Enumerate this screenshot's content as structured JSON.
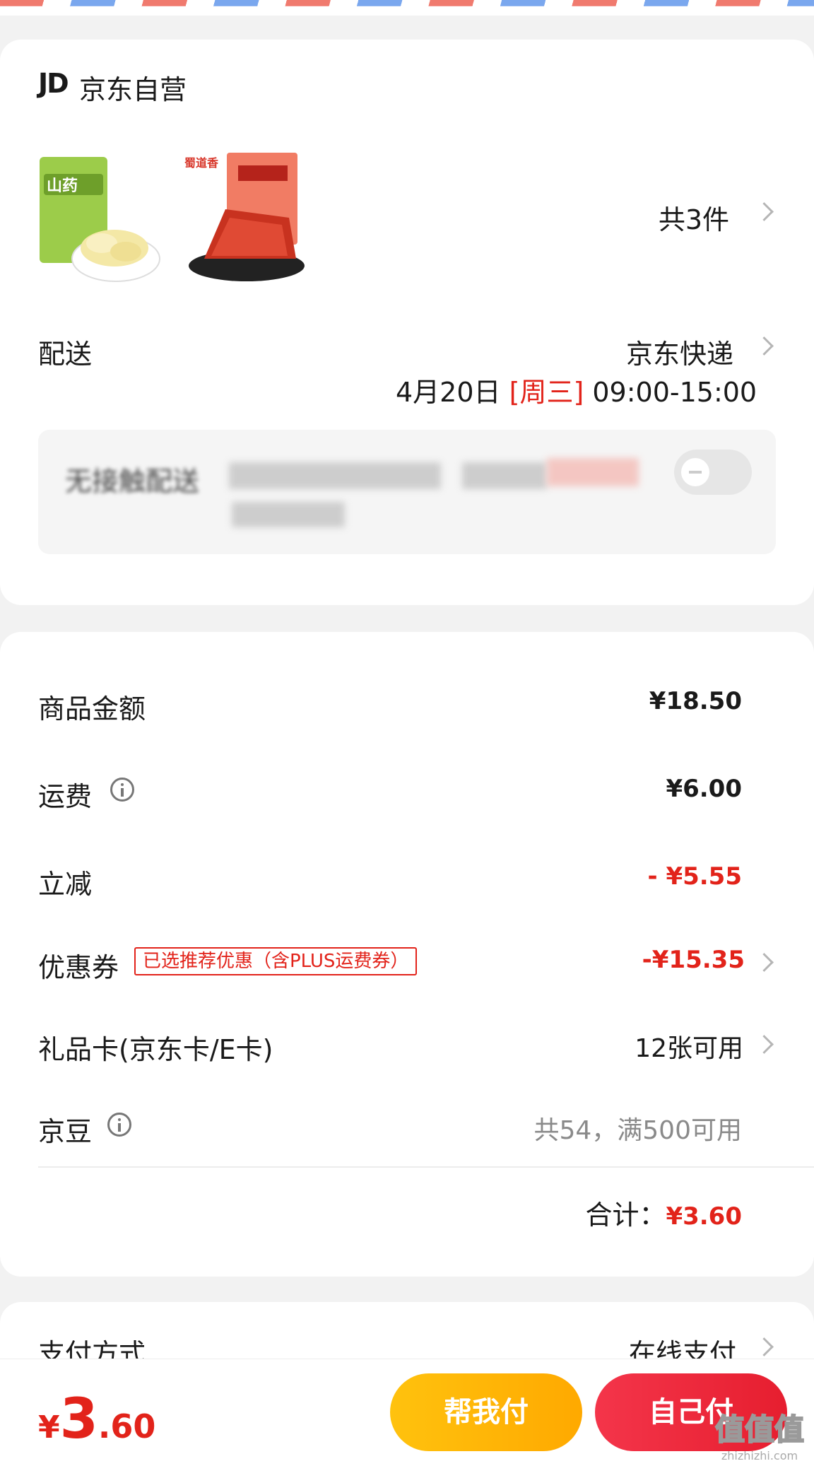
{
  "store": {
    "logo": "JD",
    "name": "京东自营",
    "item_count": "共3件",
    "products": [
      {
        "icon": "yam-chips-product-image",
        "label": "山药脆片"
      },
      {
        "icon": "spicy-meat-jerky-product-image",
        "label": "蜀道香"
      }
    ]
  },
  "delivery": {
    "label": "配送",
    "method": "京东快递",
    "date": "4月20日",
    "weekday": "[周三]",
    "time": "09:00-15:00"
  },
  "contactless": {
    "label_fragment": "无接触配送"
  },
  "costs": {
    "goods_label": "商品金额",
    "goods_value": "¥18.50",
    "shipping_label": "运费",
    "shipping_value": "¥6.00",
    "instant_discount_label": "立减",
    "instant_discount_value": "- ¥5.55",
    "coupon_label": "优惠券",
    "coupon_tag": "已选推荐优惠（含PLUS运费券）",
    "coupon_value": "-¥15.35",
    "giftcard_label": "礼品卡(京东卡/E卡)",
    "giftcard_value": "12张可用",
    "beans_label": "京豆",
    "beans_value": "共54，满500可用",
    "total_label": "合计：",
    "total_value": "¥3.60"
  },
  "payment": {
    "label": "支付方式",
    "value": "在线支付"
  },
  "bottom_bar": {
    "currency": "¥",
    "amount_int": "3",
    "amount_dec": ".60",
    "help_pay_label": "帮我付",
    "self_pay_label": "自己付",
    "watermark": "值值值",
    "watermark_sub": "zhizhizhi.com"
  },
  "colors": {
    "accent_red": "#e2231a",
    "help_btn": "#ffb300",
    "self_btn": "#f2283a"
  }
}
